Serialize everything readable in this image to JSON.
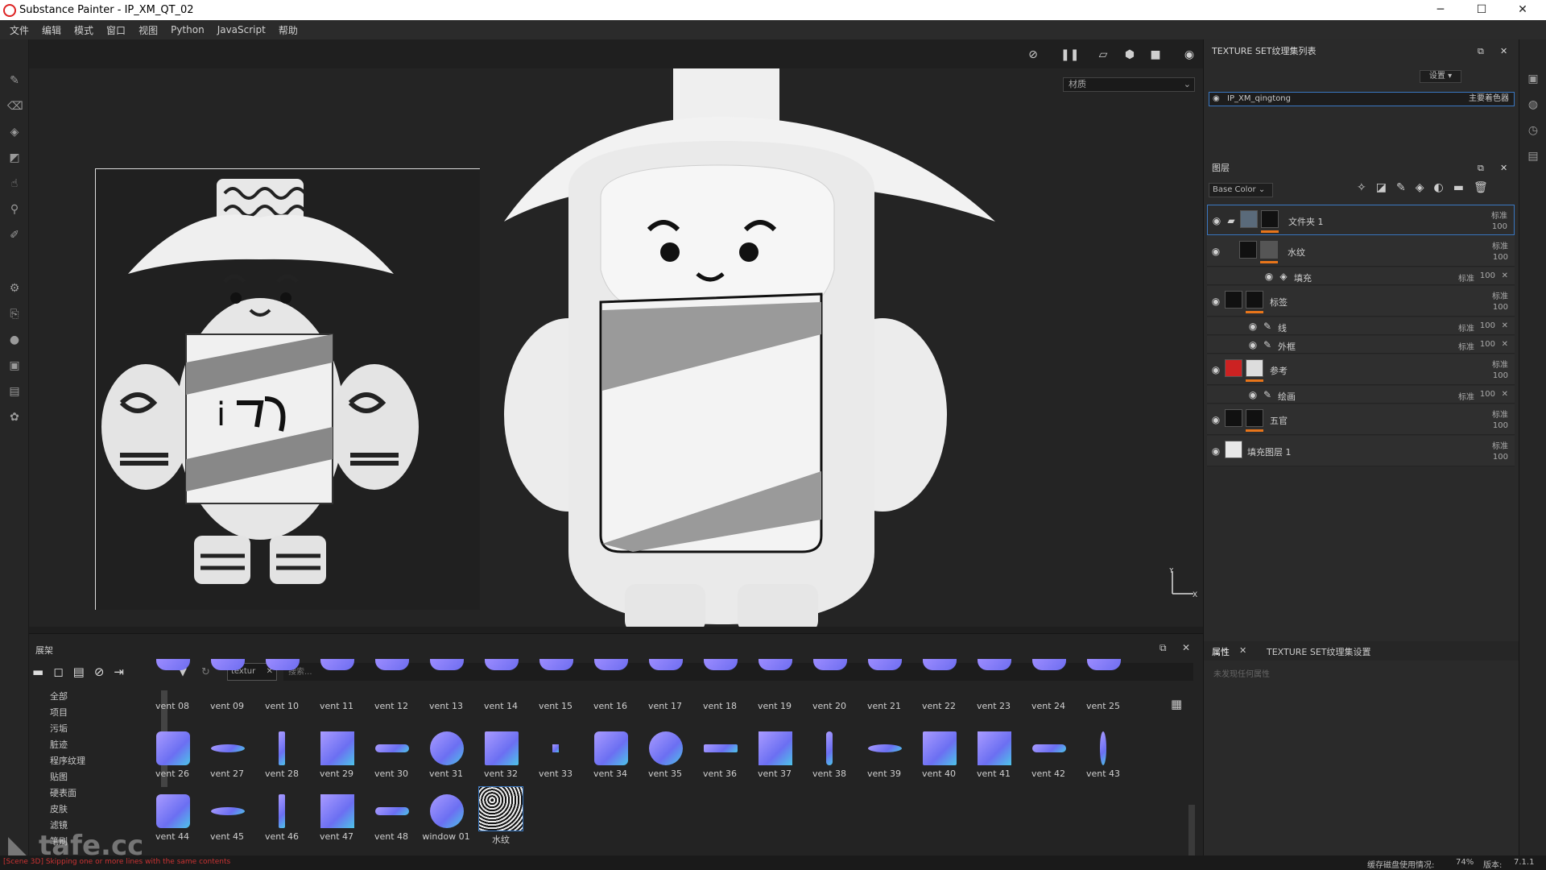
{
  "window": {
    "title": "Substance Painter - IP_XM_QT_02",
    "minimize": "─",
    "maximize": "☐",
    "close": "✕"
  },
  "menu": [
    "文件",
    "编辑",
    "模式",
    "窗口",
    "视图",
    "Python",
    "JavaScript",
    "帮助"
  ],
  "viewport": {
    "material_select": "材质"
  },
  "texture_set_panel": {
    "title": "TEXTURE SET纹理集列表",
    "settings": "设置 ▾",
    "item_name": "IP_XM_qingtong",
    "item_shader": "主要着色器"
  },
  "layers_panel": {
    "title": "图层",
    "channel": "Base Color",
    "layers": [
      {
        "name": "文件夹 1",
        "blend": "标准",
        "opacity": "100"
      },
      {
        "name": "水纹",
        "blend": "标准",
        "opacity": "100"
      },
      {
        "name": "填充",
        "blend": "标准",
        "opacity": "100"
      },
      {
        "name": "标签",
        "blend": "标准",
        "opacity": "100"
      },
      {
        "name": "线",
        "blend": "标准",
        "opacity": "100"
      },
      {
        "name": "外框",
        "blend": "标准",
        "opacity": "100"
      },
      {
        "name": "参考",
        "blend": "标准",
        "opacity": "100"
      },
      {
        "name": "绘画",
        "blend": "标准",
        "opacity": "100"
      },
      {
        "name": "五官",
        "blend": "标准",
        "opacity": "100"
      },
      {
        "name": "填充图层 1",
        "blend": "标准",
        "opacity": "100"
      }
    ]
  },
  "properties_panel": {
    "tab1": "属性",
    "tab2": "TEXTURE SET纹理集设置",
    "empty": "未发现任何属性"
  },
  "shelf": {
    "title": "展架",
    "filter_tag": "textur",
    "search_placeholder": "搜索...",
    "categories": [
      "全部",
      "项目",
      "污垢",
      "脏迹",
      "程序纹理",
      "贴图",
      "硬表面",
      "皮肤",
      "滤镜",
      "笔刷"
    ],
    "row1": [
      "vent 08",
      "vent 09",
      "vent 10",
      "vent 11",
      "vent 12",
      "vent 13",
      "vent 14",
      "vent 15",
      "vent 16",
      "vent 17",
      "vent 18",
      "vent 19",
      "vent 20",
      "vent 21",
      "vent 22",
      "vent 23",
      "vent 24",
      "vent 25"
    ],
    "row2": [
      "vent 26",
      "vent 27",
      "vent 28",
      "vent 29",
      "vent 30",
      "vent 31",
      "vent 32",
      "vent 33",
      "vent 34",
      "vent 35",
      "vent 36",
      "vent 37",
      "vent 38",
      "vent 39",
      "vent 40",
      "vent 41",
      "vent 42",
      "vent 43"
    ],
    "row3": [
      "vent 44",
      "vent 45",
      "vent 46",
      "vent 47",
      "vent 48",
      "window 01",
      "水纹"
    ]
  },
  "status": {
    "log": "[Scene 3D] Skipping one or more lines with the same contents",
    "cache": "缓存磁盘使用情况:",
    "cache_value": "74%",
    "version_label": "版本:",
    "version": "7.1.1"
  },
  "watermark": "tafe.cc",
  "colors": {
    "accent": "#3a78c2",
    "mask_bar": "#e8751a",
    "normal_map": "#7f7fff"
  }
}
